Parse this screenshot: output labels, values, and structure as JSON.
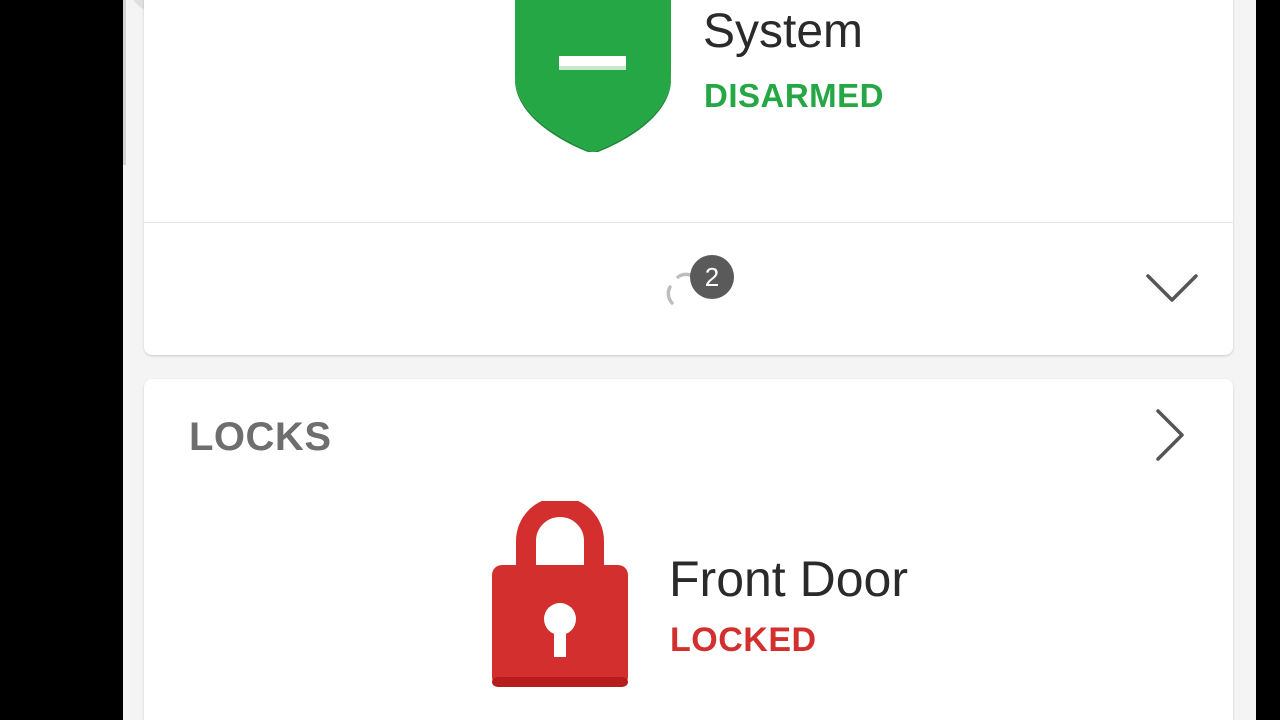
{
  "colors": {
    "screen_bg": "#f4f4f4",
    "card_bg": "#ffffff",
    "shield_green": "#25a745",
    "disarmed_green": "#25a745",
    "lock_red": "#d32f2f",
    "badge_gray": "#5a5a5a",
    "title_gray": "#6e6e6e"
  },
  "security": {
    "icon": "shield-disarmed-icon",
    "name": "System",
    "status": "DISARMED"
  },
  "sync": {
    "icon": "sync-icon",
    "badge_count": "2"
  },
  "locks_section": {
    "title": "LOCKS",
    "nav_icon": "chevron-right-icon",
    "items": [
      {
        "icon": "padlock-icon",
        "name": "Front Door",
        "status": "LOCKED"
      }
    ]
  }
}
